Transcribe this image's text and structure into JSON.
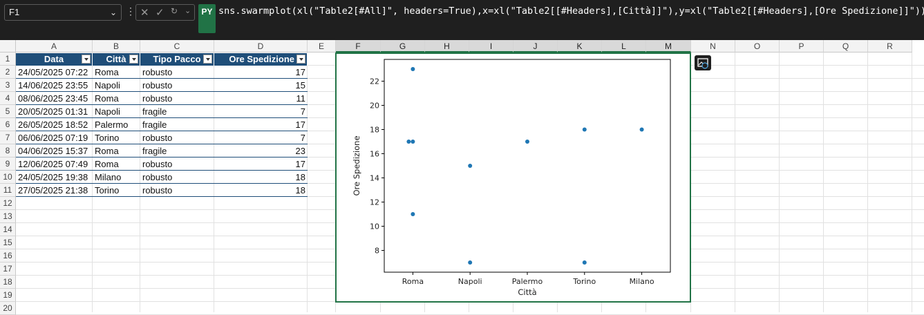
{
  "namebox": {
    "value": "F1"
  },
  "formula": {
    "badge": "PY",
    "text": "sns.swarmplot(xl(\"Table2[#All]\", headers=True),x=xl(\"Table2[[#Headers],[Città]]\"),y=xl(\"Table2[[#Headers],[Ore Spedizione]]\"))"
  },
  "columns": [
    "A",
    "B",
    "C",
    "D",
    "E",
    "F",
    "G",
    "H",
    "I",
    "J",
    "K",
    "L",
    "M",
    "N",
    "O",
    "P",
    "Q",
    "R"
  ],
  "rows": [
    "1",
    "2",
    "3",
    "4",
    "5",
    "6",
    "7",
    "8",
    "9",
    "10",
    "11",
    "12",
    "13",
    "14",
    "15",
    "16",
    "17",
    "18",
    "19",
    "20"
  ],
  "table": {
    "headers": [
      "Data",
      "Città",
      "Tipo Pacco",
      "Ore Spedizione"
    ],
    "rows": [
      [
        "24/05/2025 07:22",
        "Roma",
        "robusto",
        "17"
      ],
      [
        "14/06/2025 23:55",
        "Napoli",
        "robusto",
        "15"
      ],
      [
        "08/06/2025 23:45",
        "Roma",
        "robusto",
        "11"
      ],
      [
        "20/05/2025 01:31",
        "Napoli",
        "fragile",
        "7"
      ],
      [
        "26/05/2025 18:52",
        "Palermo",
        "fragile",
        "17"
      ],
      [
        "06/06/2025 07:19",
        "Torino",
        "robusto",
        "7"
      ],
      [
        "04/06/2025 15:37",
        "Roma",
        "fragile",
        "23"
      ],
      [
        "12/06/2025 07:49",
        "Roma",
        "robusto",
        "17"
      ],
      [
        "24/05/2025 19:38",
        "Milano",
        "robusto",
        "18"
      ],
      [
        "27/05/2025 21:38",
        "Torino",
        "robusto",
        "18"
      ]
    ]
  },
  "chart_data": {
    "type": "scatter",
    "xlabel": "Città",
    "ylabel": "Ore Spedizione",
    "categories": [
      "Roma",
      "Napoli",
      "Palermo",
      "Torino",
      "Milano"
    ],
    "points": [
      {
        "x": "Roma",
        "y": 17
      },
      {
        "x": "Roma",
        "y": 11
      },
      {
        "x": "Roma",
        "y": 23
      },
      {
        "x": "Roma",
        "y": 17
      },
      {
        "x": "Napoli",
        "y": 15
      },
      {
        "x": "Napoli",
        "y": 7
      },
      {
        "x": "Palermo",
        "y": 17
      },
      {
        "x": "Torino",
        "y": 7
      },
      {
        "x": "Torino",
        "y": 18
      },
      {
        "x": "Milano",
        "y": 18
      }
    ],
    "yticks": [
      8,
      10,
      12,
      14,
      16,
      18,
      20,
      22
    ],
    "ylim": [
      6.2,
      23.8
    ],
    "color": "#1f77b4",
    "grid": false
  }
}
